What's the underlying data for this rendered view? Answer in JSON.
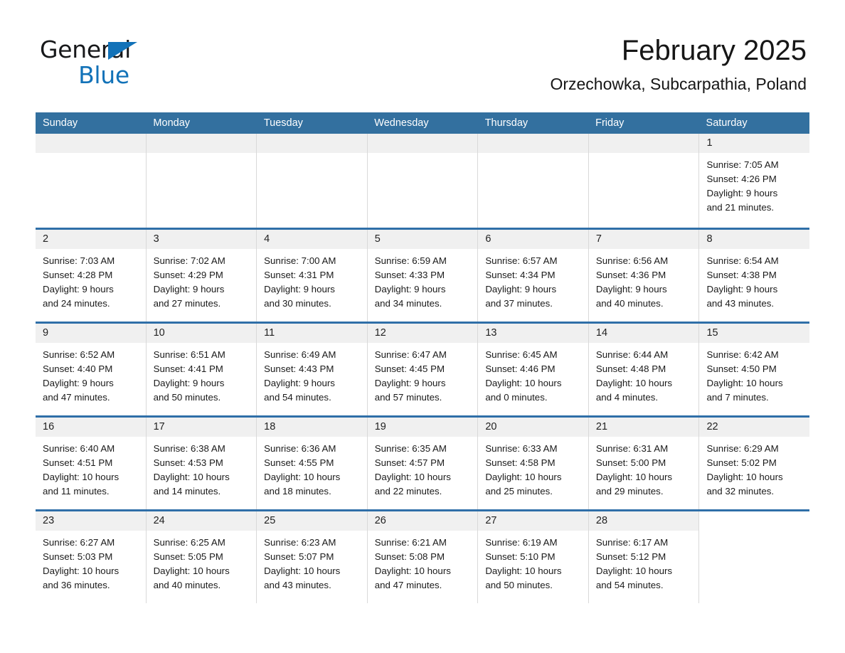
{
  "brand": {
    "name_top": "General",
    "name_bottom": "Blue",
    "accent_color": "#1272b8",
    "triangle_icon": "brand-triangle-icon"
  },
  "header": {
    "title": "February 2025",
    "subtitle": "Orzechowka, Subcarpathia, Poland"
  },
  "theme": {
    "header_row_bg": "#33709f",
    "week_divider": "#2f6fa8",
    "day_number_bg": "#f0f0f0",
    "cell_border": "#d9d9d9"
  },
  "weekdays": [
    "Sunday",
    "Monday",
    "Tuesday",
    "Wednesday",
    "Thursday",
    "Friday",
    "Saturday"
  ],
  "weeks": [
    {
      "days": [
        {
          "type": "empty",
          "number": "",
          "lines": []
        },
        {
          "type": "empty",
          "number": "",
          "lines": []
        },
        {
          "type": "empty",
          "number": "",
          "lines": []
        },
        {
          "type": "empty",
          "number": "",
          "lines": []
        },
        {
          "type": "empty",
          "number": "",
          "lines": []
        },
        {
          "type": "empty",
          "number": "",
          "lines": []
        },
        {
          "type": "day",
          "number": "1",
          "sunrise": "Sunrise: 7:05 AM",
          "sunset": "Sunset: 4:26 PM",
          "daylight_line1": "Daylight: 9 hours",
          "daylight_line2": "and 21 minutes."
        }
      ]
    },
    {
      "days": [
        {
          "type": "day",
          "number": "2",
          "sunrise": "Sunrise: 7:03 AM",
          "sunset": "Sunset: 4:28 PM",
          "daylight_line1": "Daylight: 9 hours",
          "daylight_line2": "and 24 minutes."
        },
        {
          "type": "day",
          "number": "3",
          "sunrise": "Sunrise: 7:02 AM",
          "sunset": "Sunset: 4:29 PM",
          "daylight_line1": "Daylight: 9 hours",
          "daylight_line2": "and 27 minutes."
        },
        {
          "type": "day",
          "number": "4",
          "sunrise": "Sunrise: 7:00 AM",
          "sunset": "Sunset: 4:31 PM",
          "daylight_line1": "Daylight: 9 hours",
          "daylight_line2": "and 30 minutes."
        },
        {
          "type": "day",
          "number": "5",
          "sunrise": "Sunrise: 6:59 AM",
          "sunset": "Sunset: 4:33 PM",
          "daylight_line1": "Daylight: 9 hours",
          "daylight_line2": "and 34 minutes."
        },
        {
          "type": "day",
          "number": "6",
          "sunrise": "Sunrise: 6:57 AM",
          "sunset": "Sunset: 4:34 PM",
          "daylight_line1": "Daylight: 9 hours",
          "daylight_line2": "and 37 minutes."
        },
        {
          "type": "day",
          "number": "7",
          "sunrise": "Sunrise: 6:56 AM",
          "sunset": "Sunset: 4:36 PM",
          "daylight_line1": "Daylight: 9 hours",
          "daylight_line2": "and 40 minutes."
        },
        {
          "type": "day",
          "number": "8",
          "sunrise": "Sunrise: 6:54 AM",
          "sunset": "Sunset: 4:38 PM",
          "daylight_line1": "Daylight: 9 hours",
          "daylight_line2": "and 43 minutes."
        }
      ]
    },
    {
      "days": [
        {
          "type": "day",
          "number": "9",
          "sunrise": "Sunrise: 6:52 AM",
          "sunset": "Sunset: 4:40 PM",
          "daylight_line1": "Daylight: 9 hours",
          "daylight_line2": "and 47 minutes."
        },
        {
          "type": "day",
          "number": "10",
          "sunrise": "Sunrise: 6:51 AM",
          "sunset": "Sunset: 4:41 PM",
          "daylight_line1": "Daylight: 9 hours",
          "daylight_line2": "and 50 minutes."
        },
        {
          "type": "day",
          "number": "11",
          "sunrise": "Sunrise: 6:49 AM",
          "sunset": "Sunset: 4:43 PM",
          "daylight_line1": "Daylight: 9 hours",
          "daylight_line2": "and 54 minutes."
        },
        {
          "type": "day",
          "number": "12",
          "sunrise": "Sunrise: 6:47 AM",
          "sunset": "Sunset: 4:45 PM",
          "daylight_line1": "Daylight: 9 hours",
          "daylight_line2": "and 57 minutes."
        },
        {
          "type": "day",
          "number": "13",
          "sunrise": "Sunrise: 6:45 AM",
          "sunset": "Sunset: 4:46 PM",
          "daylight_line1": "Daylight: 10 hours",
          "daylight_line2": "and 0 minutes."
        },
        {
          "type": "day",
          "number": "14",
          "sunrise": "Sunrise: 6:44 AM",
          "sunset": "Sunset: 4:48 PM",
          "daylight_line1": "Daylight: 10 hours",
          "daylight_line2": "and 4 minutes."
        },
        {
          "type": "day",
          "number": "15",
          "sunrise": "Sunrise: 6:42 AM",
          "sunset": "Sunset: 4:50 PM",
          "daylight_line1": "Daylight: 10 hours",
          "daylight_line2": "and 7 minutes."
        }
      ]
    },
    {
      "days": [
        {
          "type": "day",
          "number": "16",
          "sunrise": "Sunrise: 6:40 AM",
          "sunset": "Sunset: 4:51 PM",
          "daylight_line1": "Daylight: 10 hours",
          "daylight_line2": "and 11 minutes."
        },
        {
          "type": "day",
          "number": "17",
          "sunrise": "Sunrise: 6:38 AM",
          "sunset": "Sunset: 4:53 PM",
          "daylight_line1": "Daylight: 10 hours",
          "daylight_line2": "and 14 minutes."
        },
        {
          "type": "day",
          "number": "18",
          "sunrise": "Sunrise: 6:36 AM",
          "sunset": "Sunset: 4:55 PM",
          "daylight_line1": "Daylight: 10 hours",
          "daylight_line2": "and 18 minutes."
        },
        {
          "type": "day",
          "number": "19",
          "sunrise": "Sunrise: 6:35 AM",
          "sunset": "Sunset: 4:57 PM",
          "daylight_line1": "Daylight: 10 hours",
          "daylight_line2": "and 22 minutes."
        },
        {
          "type": "day",
          "number": "20",
          "sunrise": "Sunrise: 6:33 AM",
          "sunset": "Sunset: 4:58 PM",
          "daylight_line1": "Daylight: 10 hours",
          "daylight_line2": "and 25 minutes."
        },
        {
          "type": "day",
          "number": "21",
          "sunrise": "Sunrise: 6:31 AM",
          "sunset": "Sunset: 5:00 PM",
          "daylight_line1": "Daylight: 10 hours",
          "daylight_line2": "and 29 minutes."
        },
        {
          "type": "day",
          "number": "22",
          "sunrise": "Sunrise: 6:29 AM",
          "sunset": "Sunset: 5:02 PM",
          "daylight_line1": "Daylight: 10 hours",
          "daylight_line2": "and 32 minutes."
        }
      ]
    },
    {
      "days": [
        {
          "type": "day",
          "number": "23",
          "sunrise": "Sunrise: 6:27 AM",
          "sunset": "Sunset: 5:03 PM",
          "daylight_line1": "Daylight: 10 hours",
          "daylight_line2": "and 36 minutes."
        },
        {
          "type": "day",
          "number": "24",
          "sunrise": "Sunrise: 6:25 AM",
          "sunset": "Sunset: 5:05 PM",
          "daylight_line1": "Daylight: 10 hours",
          "daylight_line2": "and 40 minutes."
        },
        {
          "type": "day",
          "number": "25",
          "sunrise": "Sunrise: 6:23 AM",
          "sunset": "Sunset: 5:07 PM",
          "daylight_line1": "Daylight: 10 hours",
          "daylight_line2": "and 43 minutes."
        },
        {
          "type": "day",
          "number": "26",
          "sunrise": "Sunrise: 6:21 AM",
          "sunset": "Sunset: 5:08 PM",
          "daylight_line1": "Daylight: 10 hours",
          "daylight_line2": "and 47 minutes."
        },
        {
          "type": "day",
          "number": "27",
          "sunrise": "Sunrise: 6:19 AM",
          "sunset": "Sunset: 5:10 PM",
          "daylight_line1": "Daylight: 10 hours",
          "daylight_line2": "and 50 minutes."
        },
        {
          "type": "day",
          "number": "28",
          "sunrise": "Sunrise: 6:17 AM",
          "sunset": "Sunset: 5:12 PM",
          "daylight_line1": "Daylight: 10 hours",
          "daylight_line2": "and 54 minutes."
        },
        {
          "type": "blank",
          "number": "",
          "lines": []
        }
      ]
    }
  ]
}
